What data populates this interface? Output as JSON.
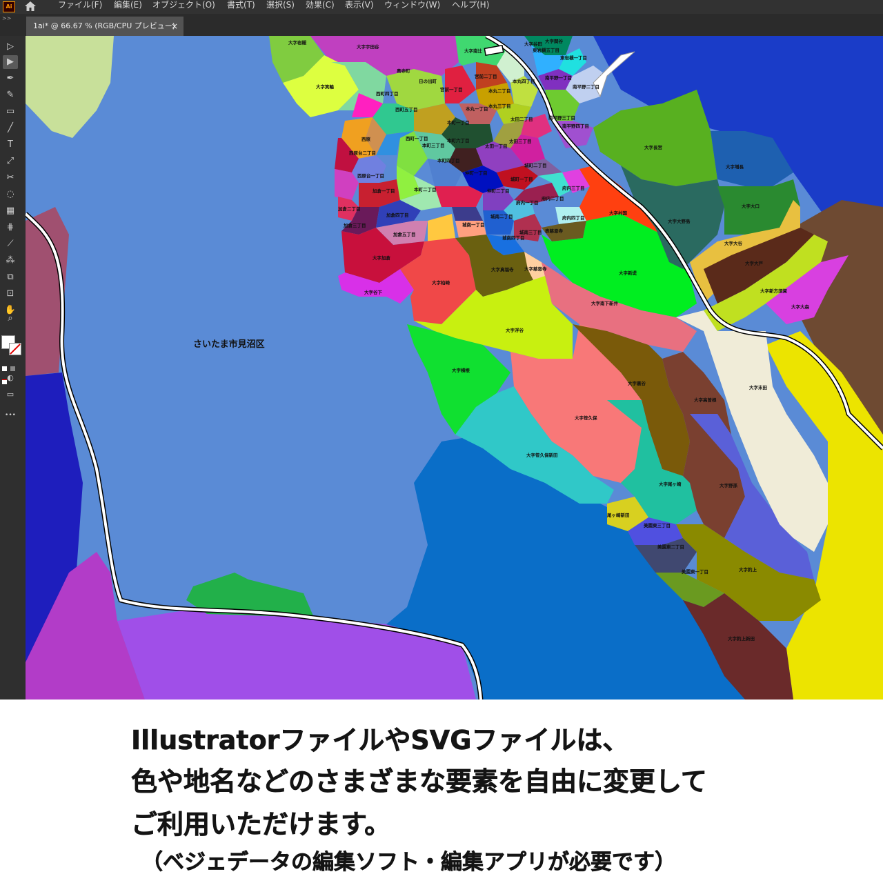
{
  "app": {
    "logo_text": "Ai",
    "menu": [
      "ファイル(F)",
      "編集(E)",
      "オブジェクト(O)",
      "書式(T)",
      "選択(S)",
      "効果(C)",
      "表示(V)",
      "ウィンドウ(W)",
      "ヘルプ(H)"
    ],
    "panel_arrows": ">>",
    "document_tab": {
      "title": "1ai* @ 66.67 % (RGB/CPU プレビュー)",
      "close": "×"
    }
  },
  "tools": [
    {
      "name": "selection-tool",
      "icon": "▷"
    },
    {
      "name": "direct-selection-tool",
      "icon": "▶"
    },
    {
      "name": "pen-tool",
      "icon": "✒"
    },
    {
      "name": "curvature-tool",
      "icon": "✎"
    },
    {
      "name": "rectangle-tool",
      "icon": "▭"
    },
    {
      "name": "paintbrush-tool",
      "icon": "╱"
    },
    {
      "name": "type-tool",
      "icon": "T"
    },
    {
      "name": "scale-tool",
      "icon": "⤢"
    },
    {
      "name": "scissors-tool",
      "icon": "✂"
    },
    {
      "name": "lasso-tool",
      "icon": "◌"
    },
    {
      "name": "gradient-tool",
      "icon": "▦"
    },
    {
      "name": "mesh-tool",
      "icon": "⋕"
    },
    {
      "name": "eyedropper-tool",
      "icon": "⟋"
    },
    {
      "name": "blend-tool",
      "icon": "⁂"
    },
    {
      "name": "shape-builder-tool",
      "icon": "⧉"
    },
    {
      "name": "artboard-tool",
      "icon": "⊡"
    },
    {
      "name": "hand-tool",
      "icon": "✋"
    },
    {
      "name": "zoom-tool",
      "icon": "⌕"
    }
  ],
  "toolbar_extra": {
    "more": "•••"
  },
  "map": {
    "region_label": "さいたま市見沼区",
    "labels": [
      "大字岩槻",
      "大字宇田谷",
      "大字南辻",
      "大字谷田",
      "大字関谷",
      "西町四丁目",
      "西町五丁目",
      "西町一丁目",
      "大字箕輪",
      "日の出町",
      "奥寺町",
      "宮前二丁目",
      "宮前一丁目",
      "本丸二丁目",
      "本丸一丁目",
      "本丸三丁目",
      "本丸四丁目",
      "東岩槻五丁目",
      "東岩槻一丁目",
      "南平野一丁目",
      "南平野二丁目",
      "南平野三丁目",
      "南平野四丁目",
      "太田二丁目",
      "太田三丁目",
      "太田一丁目",
      "本町一丁目",
      "本町二丁目",
      "本町三丁目",
      "本町四丁目",
      "本町六丁目",
      "西原",
      "西原台一丁目",
      "西原台二丁目",
      "加倉一丁目",
      "加倉二丁目",
      "加倉三丁目",
      "加倉四丁目",
      "加倉五丁目",
      "仲町一丁目",
      "仲町二丁目",
      "城南一丁目",
      "城南二丁目",
      "城南三丁目",
      "城南四丁目",
      "府内一丁目",
      "府内二丁目",
      "府内三丁目",
      "府内四丁目",
      "城町一丁目",
      "城町二丁目",
      "表慈恩寺",
      "大字加倉",
      "大字谷下",
      "大字柏崎",
      "大字真福寺",
      "大字浮谷",
      "大字横根",
      "大字笹久保",
      "大字笹久保新田",
      "大字慈恩寺",
      "大字新堤",
      "大字南下新井",
      "大字長宮",
      "大字増長",
      "大字大口",
      "大字大野島",
      "大字村国",
      "大字大谷",
      "大字大戸",
      "大字新方須賀",
      "大字大森",
      "大字末田",
      "大字高曽根",
      "大字裏谷",
      "大字野孫",
      "大字尾ヶ崎",
      "尾ヶ崎新田",
      "美園東一丁目",
      "美園東二丁目",
      "美園東三丁目",
      "大字釣上",
      "大字釣上新田"
    ]
  },
  "caption": {
    "line1": "IllustratorファイルやSVGファイルは、",
    "line2": "色や地名などのさまざまな要素を自由に変更して",
    "line3": "ご利用いただけます。",
    "line4": "（ベジェデータの編集ソフト・編集アプリが必要です）"
  }
}
